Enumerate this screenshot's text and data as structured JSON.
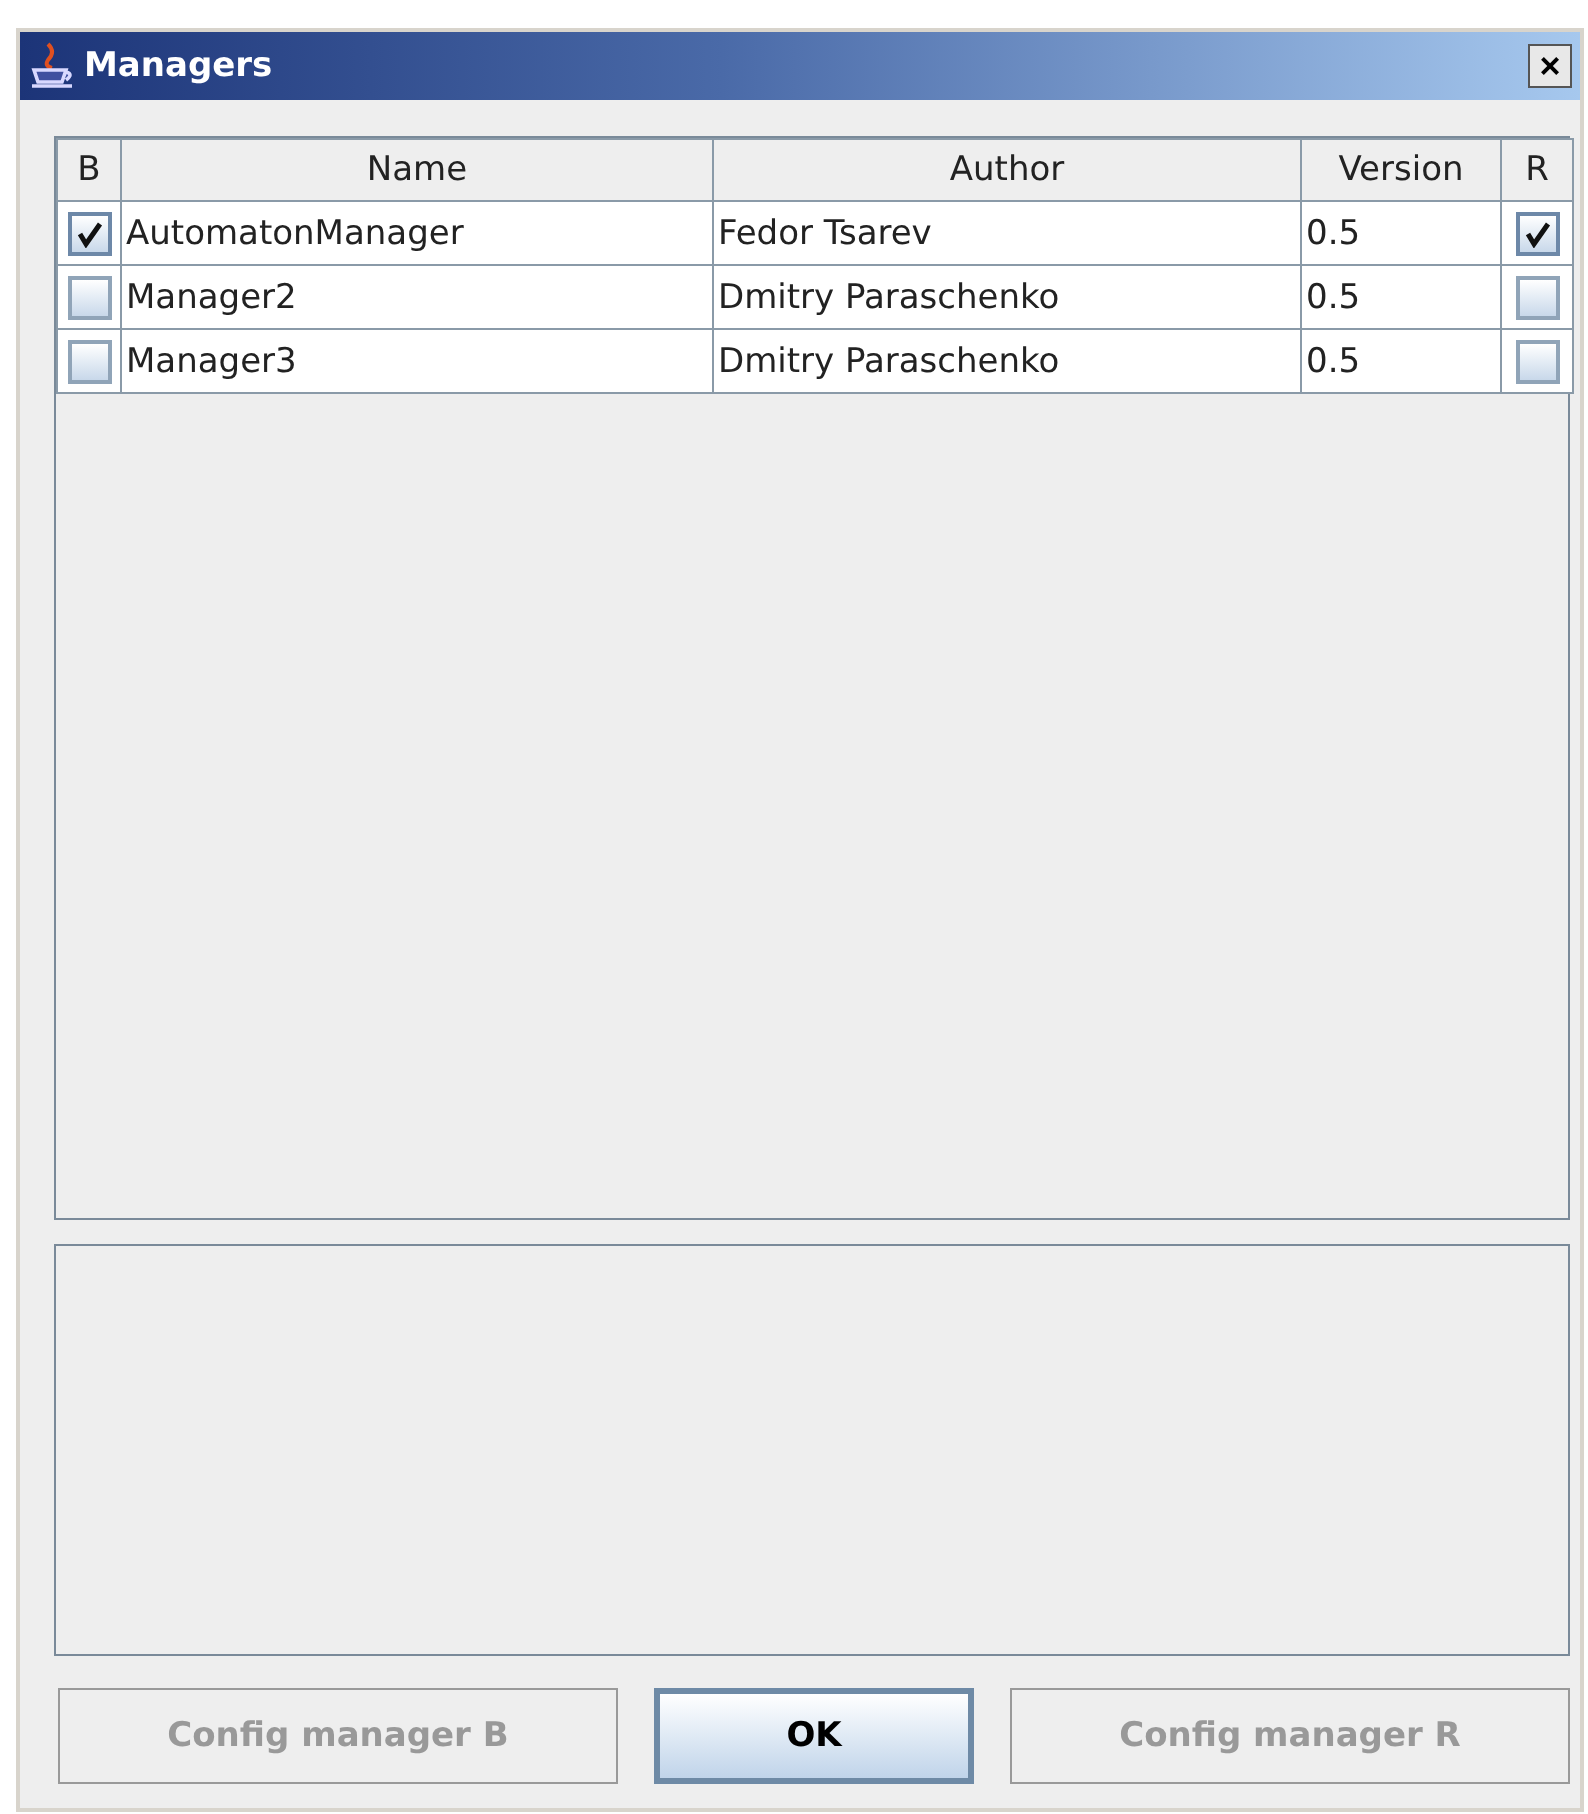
{
  "window": {
    "title": "Managers",
    "close": "×"
  },
  "table": {
    "columns": [
      "B",
      "Name",
      "Author",
      "Version",
      "R"
    ],
    "rows": [
      {
        "b_checked": true,
        "name": "AutomatonManager",
        "author": "Fedor Tsarev",
        "version": "0.5",
        "r_checked": true
      },
      {
        "b_checked": false,
        "name": "Manager2",
        "author": "Dmitry Paraschenko",
        "version": "0.5",
        "r_checked": false
      },
      {
        "b_checked": false,
        "name": "Manager3",
        "author": "Dmitry Paraschenko",
        "version": "0.5",
        "r_checked": false
      }
    ]
  },
  "buttons": [
    {
      "label": "Config manager B",
      "disabled": true,
      "default": false
    },
    {
      "label": "OK",
      "disabled": false,
      "default": true
    },
    {
      "label": "Config manager R",
      "disabled": true,
      "default": false
    }
  ]
}
